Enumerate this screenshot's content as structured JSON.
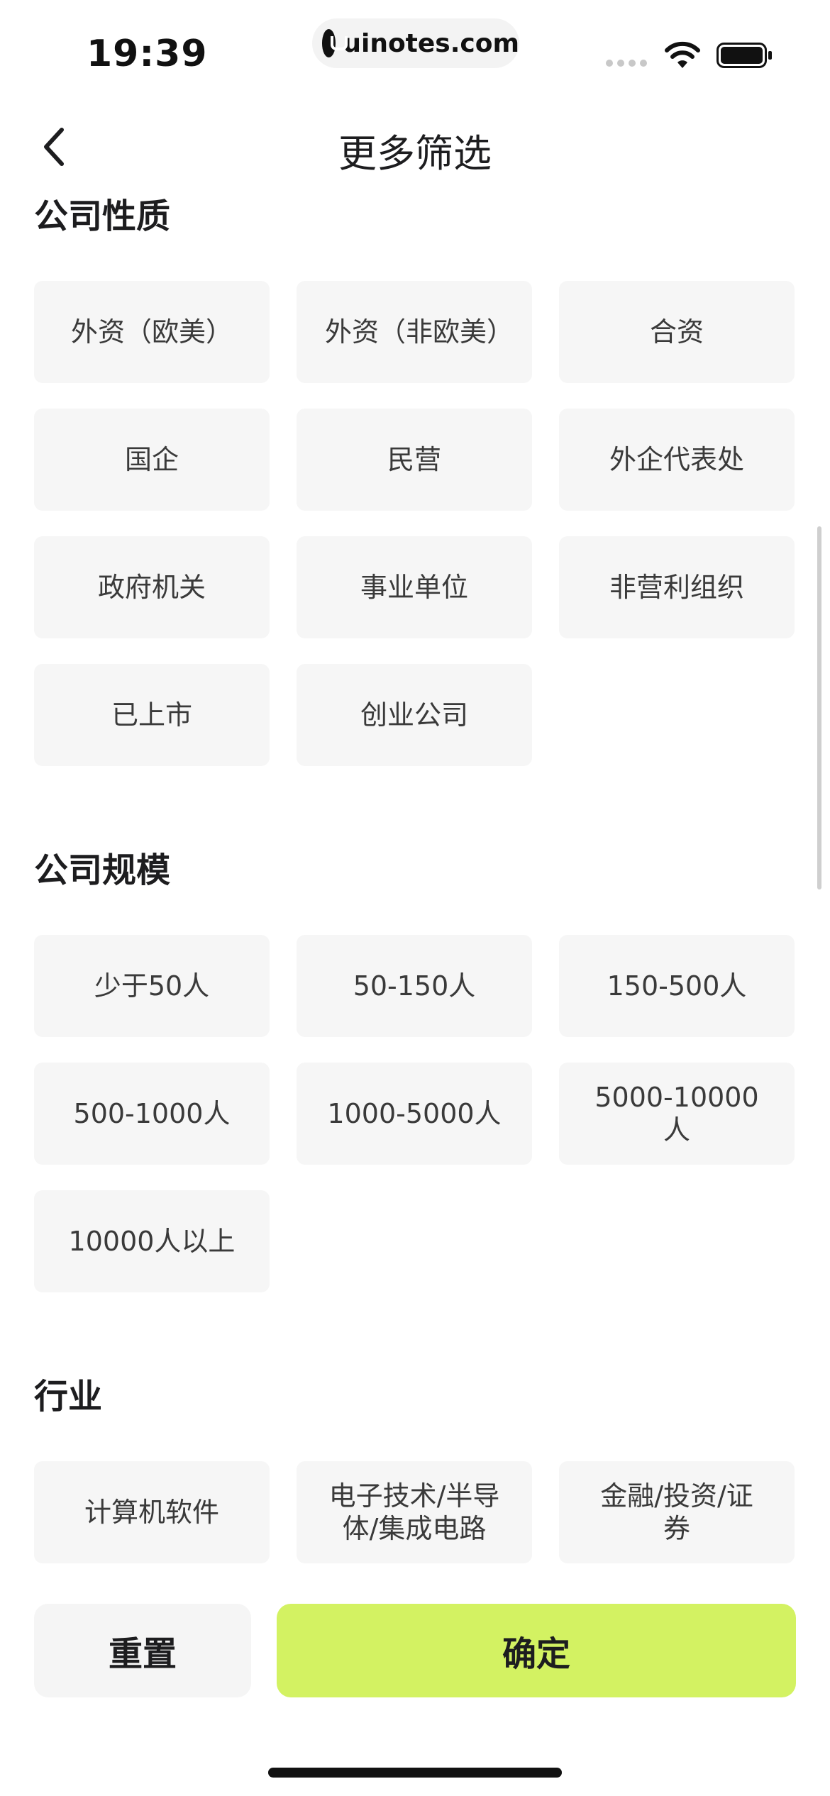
{
  "status_bar": {
    "time": "19:39",
    "url": "uinotes.com"
  },
  "nav": {
    "title": "更多筛选"
  },
  "sections": [
    {
      "title": "公司性质",
      "options": [
        "外资（欧美）",
        "外资（非欧美）",
        "合资",
        "国企",
        "民营",
        "外企代表处",
        "政府机关",
        "事业单位",
        "非营利组织",
        "已上市",
        "创业公司"
      ]
    },
    {
      "title": "公司规模",
      "options": [
        "少于50人",
        "50-150人",
        "150-500人",
        "500-1000人",
        "1000-5000人",
        "5000-10000人",
        "10000人以上"
      ]
    },
    {
      "title": "行业",
      "options": [
        "计算机软件",
        "电子技术/半导体/集成电路",
        "金融/投资/证券",
        "",
        "",
        ""
      ]
    }
  ],
  "footer": {
    "reset_label": "重置",
    "confirm_label": "确定"
  },
  "colors": {
    "accent": "#d3f262",
    "chip_bg": "#f6f6f6",
    "text": "#1d1d1f"
  }
}
